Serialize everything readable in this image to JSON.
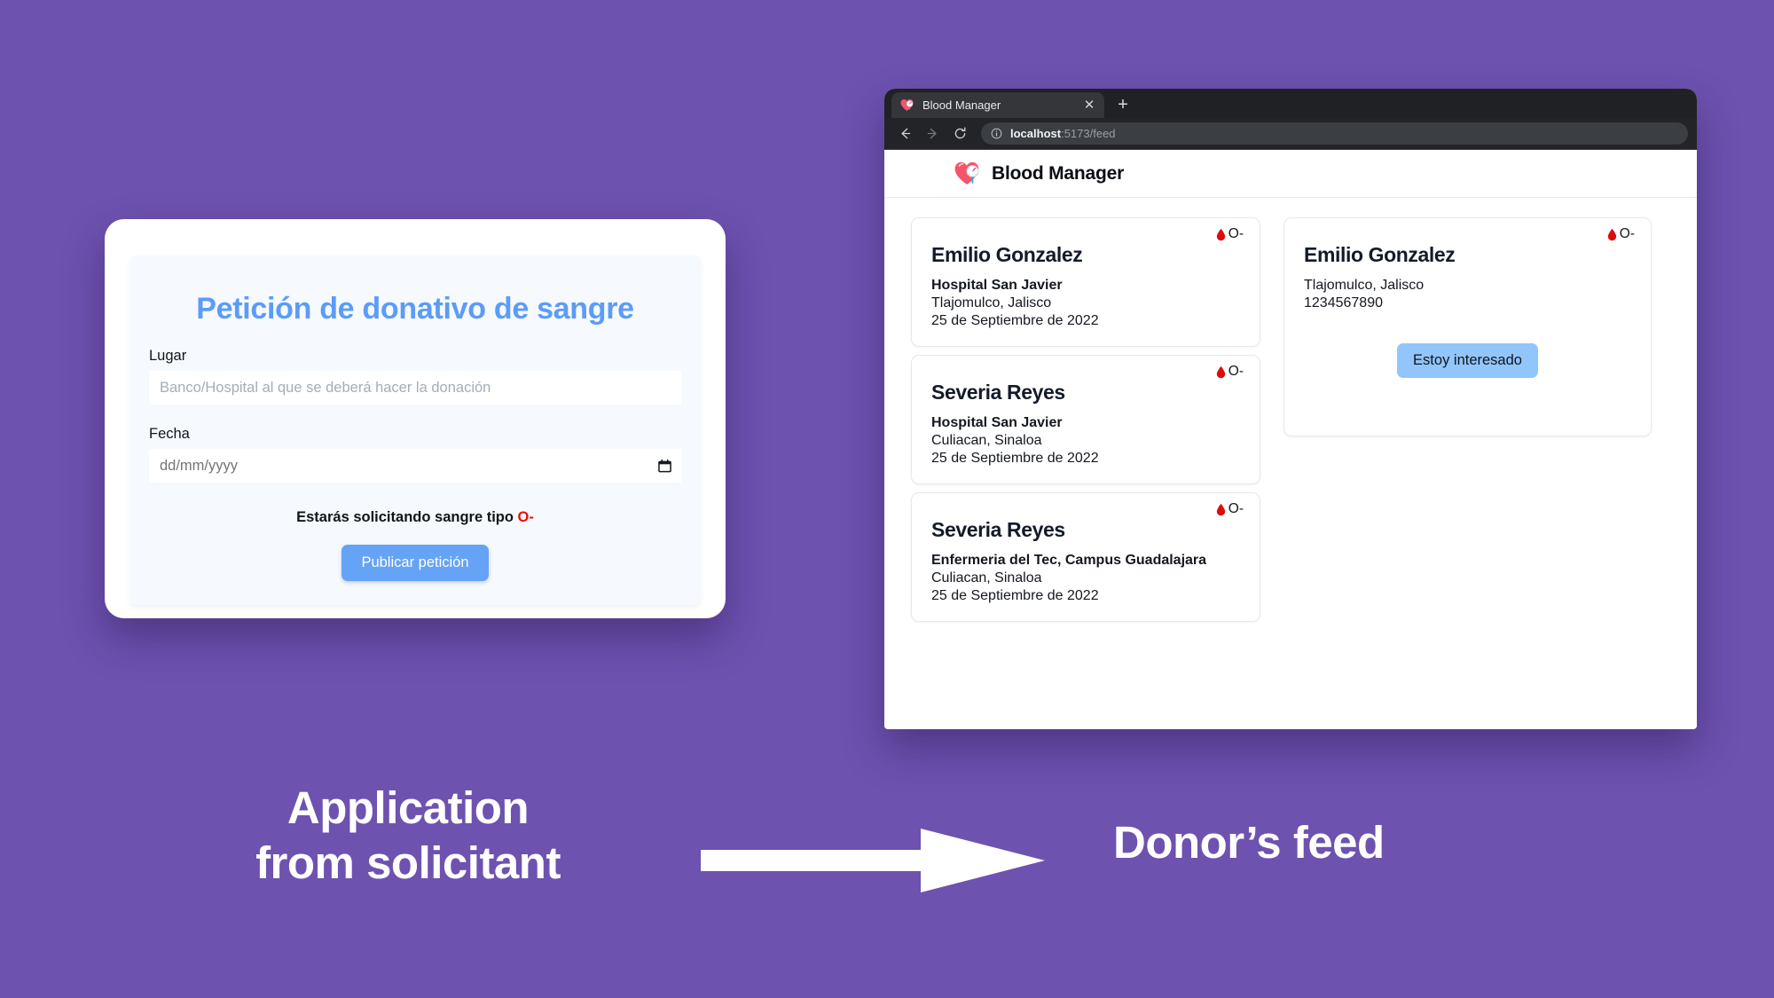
{
  "background_color": "#6d52b0",
  "accent_blue": "#5b9cf8",
  "blood_red": "#ef0b0b",
  "form": {
    "title": "Petición de donativo de sangre",
    "place_label": "Lugar",
    "place_placeholder": "Banco/Hospital al que se deberá hacer la donación",
    "place_value": "",
    "date_label": "Fecha",
    "date_placeholder": "dd/mm/yyyy",
    "date_value": "",
    "calendar_icon": "calendar-icon",
    "note_prefix": "Estarás solicitando sangre tipo ",
    "note_blood_type": "O-",
    "submit_label": "Publicar petición"
  },
  "browser": {
    "tab": {
      "favicon": "heart-gauge-favicon",
      "title": "Blood Manager",
      "close_label": "✕"
    },
    "new_tab_label": "+",
    "nav": {
      "back": "back-arrow-icon",
      "forward": "forward-arrow-icon",
      "reload": "reload-icon"
    },
    "omnibox": {
      "info_icon": "site-info-icon",
      "url_host": "localhost",
      "url_path": ":5173/feed"
    }
  },
  "app": {
    "logo": "heart-gauge-logo",
    "brand": "Blood Manager",
    "requests": [
      {
        "name": "Emilio Gonzalez",
        "blood_type": "O-",
        "place": "Hospital San Javier",
        "city": "Tlajomulco, Jalisco",
        "date": "25 de Septiembre de 2022"
      },
      {
        "name": "Severia Reyes",
        "blood_type": "O-",
        "place": "Hospital San Javier",
        "city": "Culiacan, Sinaloa",
        "date": "25 de Septiembre de 2022"
      },
      {
        "name": "Severia Reyes",
        "blood_type": "O-",
        "place": "Enfermeria del Tec, Campus Guadalajara",
        "city": "Culiacan, Sinaloa",
        "date": "25 de Septiembre de 2022"
      }
    ],
    "donor_card": {
      "name": "Emilio Gonzalez",
      "blood_type": "O-",
      "city": "Tlajomulco, Jalisco",
      "phone": "1234567890",
      "button_label": "Estoy interesado"
    }
  },
  "captions": {
    "left_line1": "Application",
    "left_line2": "from solicitant",
    "arrow": "right-arrow",
    "right": "Donor’s feed"
  }
}
